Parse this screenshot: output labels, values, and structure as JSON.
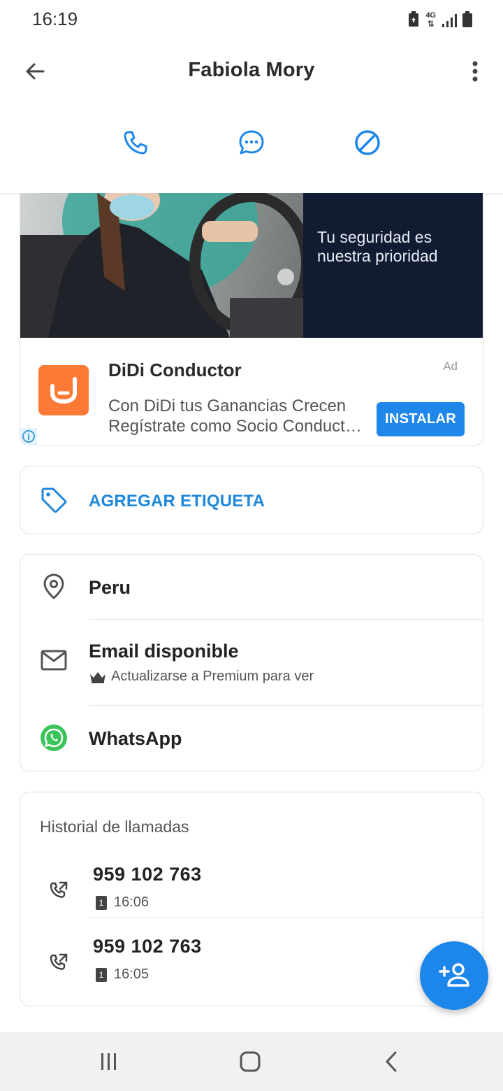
{
  "status_bar": {
    "time": "16:19",
    "network": "4G",
    "icons": [
      "battery-saver-icon",
      "4g-data-icon",
      "signal-icon",
      "battery-icon"
    ]
  },
  "header": {
    "title": "Fabiola Mory",
    "back_icon": "back-arrow-icon",
    "more_icon": "more-vert-icon"
  },
  "actions": [
    {
      "name": "call",
      "icon": "phone-icon"
    },
    {
      "name": "message",
      "icon": "chat-bubble-icon"
    },
    {
      "name": "block",
      "icon": "block-icon"
    }
  ],
  "ad": {
    "headline": "Tu seguridad es nuestra prioridad",
    "title": "DiDi Conductor",
    "tag": "Ad",
    "desc_line1": "Con DiDi tus Ganancias Crecen",
    "desc_line2": "Regístrate como Socio Conduct…",
    "cta": "INSTALAR",
    "brand_color": "#fc7a35"
  },
  "tag_card": {
    "label": "AGREGAR ETIQUETA",
    "icon": "tag-icon"
  },
  "info": {
    "location": "Peru",
    "email_title": "Email disponible",
    "email_sub": "Actualizarse a Premium para ver",
    "whatsapp": "WhatsApp"
  },
  "call_history": {
    "title": "Historial de llamadas",
    "calls": [
      {
        "number": "959 102 763",
        "time": "16:06",
        "sim": "1"
      },
      {
        "number": "959 102 763",
        "time": "16:05",
        "sim": "1"
      }
    ]
  },
  "fab": {
    "icon": "add-contact-icon"
  },
  "colors": {
    "accent": "#1c86ea",
    "whatsapp": "#3bc45a"
  }
}
